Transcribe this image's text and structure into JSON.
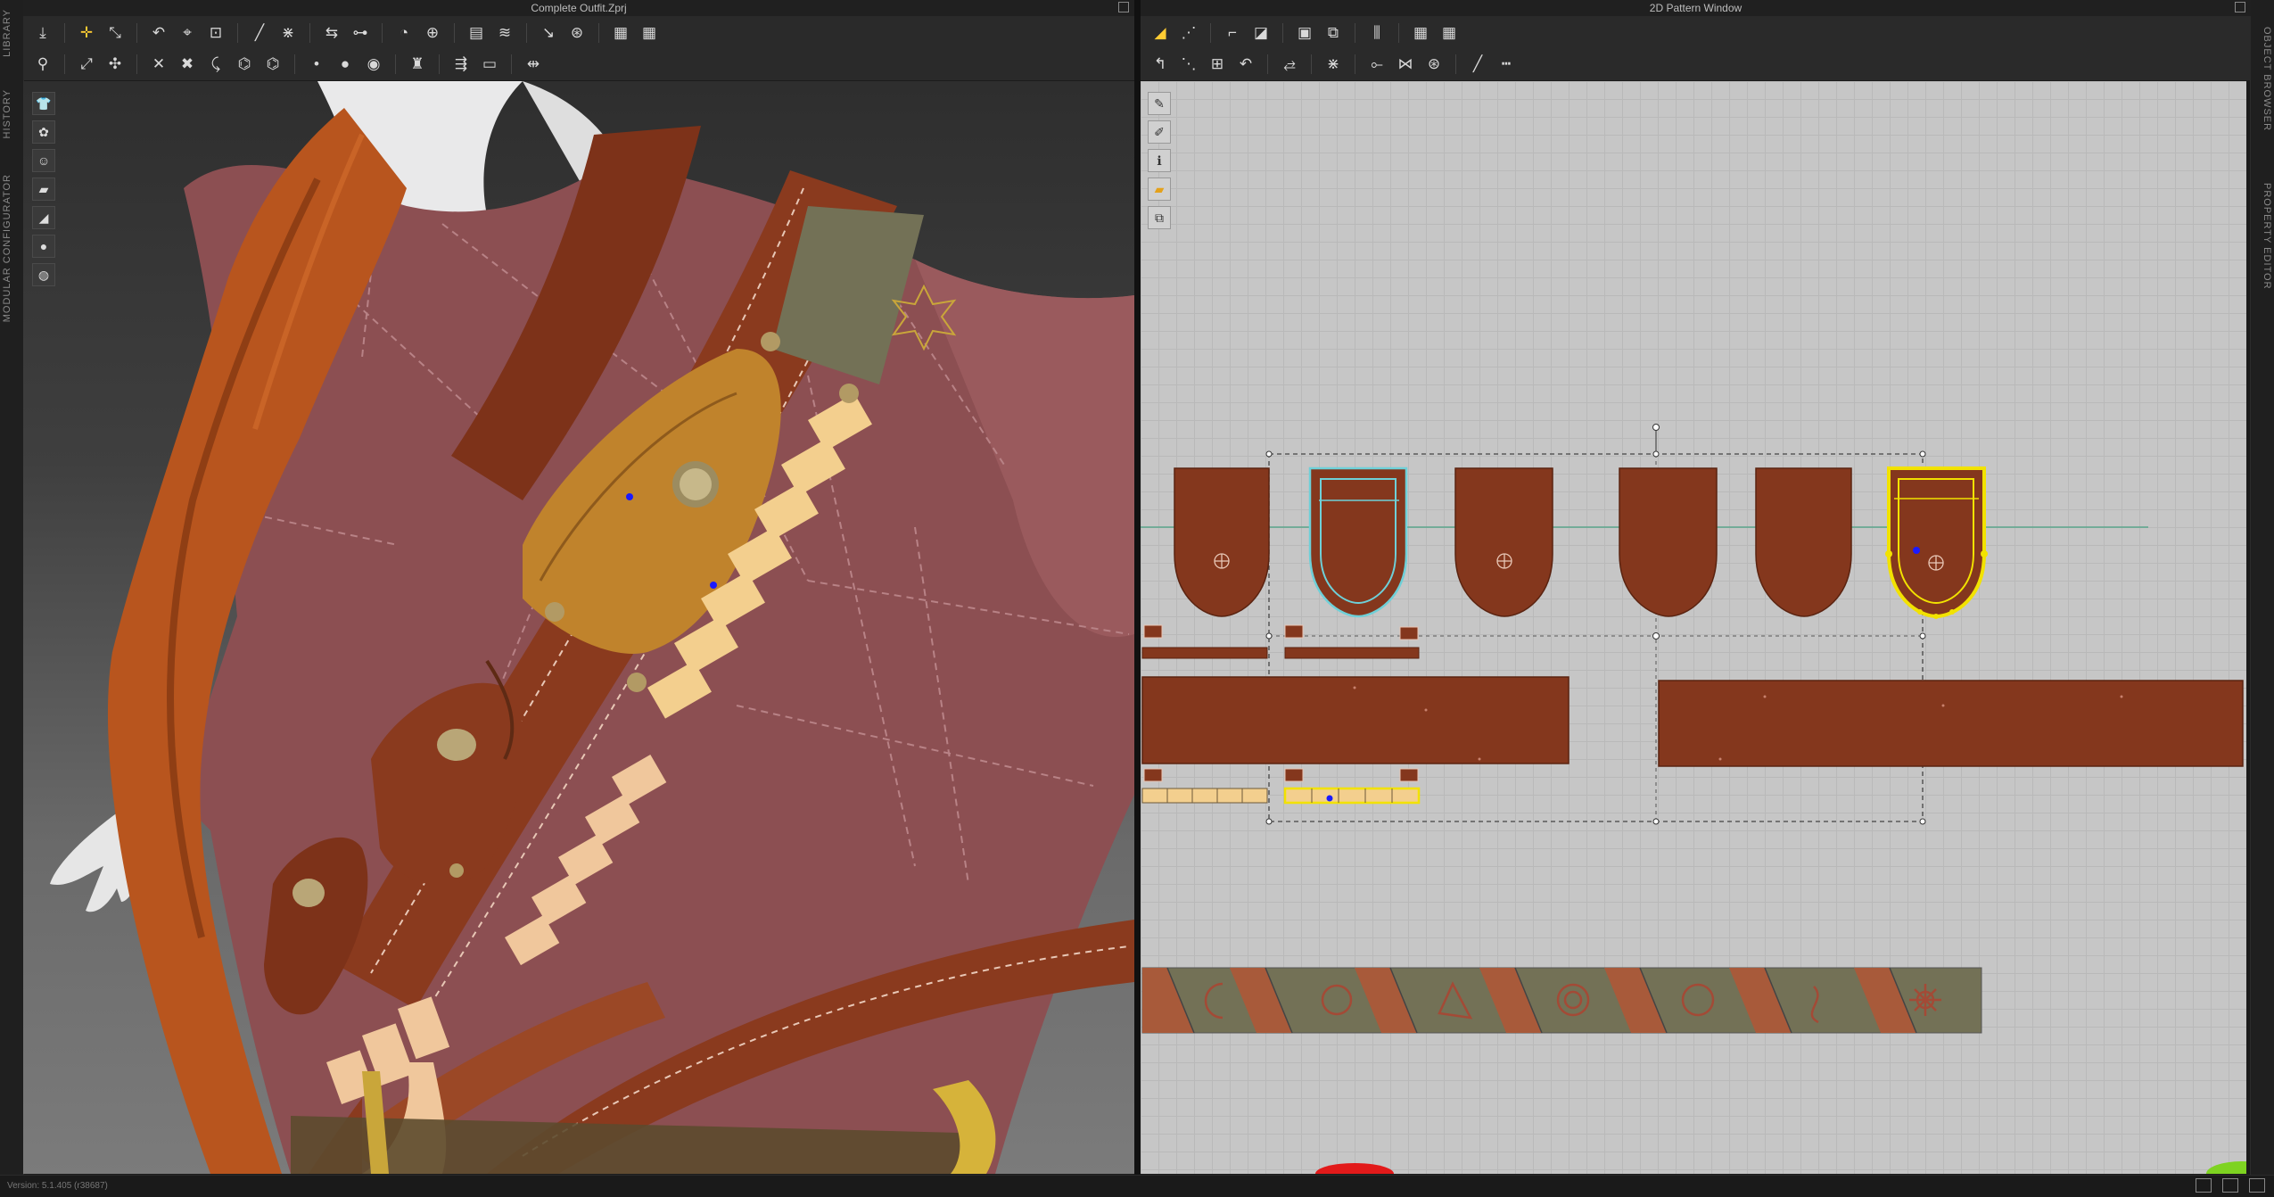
{
  "left_sidebar": {
    "tabs": [
      "LIBRARY",
      "HISTORY",
      "MODULAR CONFIGURATOR"
    ]
  },
  "right_sidebar": {
    "tabs": [
      "OBJECT BROWSER",
      "PROPERTY EDITOR"
    ]
  },
  "window3d": {
    "title": "Complete Outfit.Zprj"
  },
  "window2d": {
    "title": "2D Pattern Window"
  },
  "status": {
    "version": "Version: 5.1.405 (r38687)"
  },
  "icons": {
    "toolbar3d_row1": [
      "avatar-icon",
      "select-move-icon",
      "edit-pattern-icon",
      "fold-icon",
      "pin-icon",
      "pin-box-icon",
      "segment-icon",
      "tack-icon",
      "arrangement-icon",
      "arrange-point-icon",
      "button-icon",
      "buttonhole-icon",
      "zipper-icon",
      "puckering-icon",
      "piping-icon",
      "grid-icon",
      "grid-2-icon"
    ],
    "toolbar3d_row2": [
      "avatar-select-icon",
      "transform-icon",
      "edit-pin-icon",
      "pin-fix-icon",
      "pin-remove-icon",
      "fold-arrange-icon",
      "measure-icon",
      "circle-measure-icon",
      "point-measure-icon",
      "mannequin-icon",
      "tape-icon",
      "strap-icon",
      "align-icon"
    ],
    "toolbar2d_row1": [
      "select-pattern-icon",
      "transform-pattern-icon",
      "edit-curve-icon",
      "create-rect-icon",
      "create-polygon-icon",
      "create-internal-icon",
      "seam-icon",
      "grid-icon",
      "grid-2-icon"
    ],
    "toolbar2d_row2": [
      "trace-icon",
      "edit-point-icon",
      "add-point-icon",
      "fold-line-icon",
      "arrange-icon",
      "sew-icon",
      "free-sew-icon",
      "edit-sew-icon",
      "check-sew-icon",
      "topstitch-icon",
      "measure-ruler-icon"
    ],
    "viewport3d_tools": [
      "garment-icon",
      "texture-icon",
      "avatar-display-icon",
      "fabric-icon",
      "strap-display-icon",
      "skin-icon",
      "world-icon"
    ],
    "viewport2d_tools": [
      "brush-icon",
      "paint-icon",
      "info-icon",
      "fabric-color-icon",
      "pattern-view-icon"
    ]
  },
  "colors": {
    "shirt": "#8c4f52",
    "leather": "#8a3a1e",
    "leather_light": "#a25632",
    "cape": "#b8551e",
    "ochre_pouch": "#c0832c",
    "bullet": "#f3cf8e",
    "pattern_piece": "#84371d",
    "pattern_select": "#f2e200",
    "pattern_outline": "#6ed0d8",
    "patch_olive": "#737156",
    "gold_embroidery": "#c9a63a"
  }
}
